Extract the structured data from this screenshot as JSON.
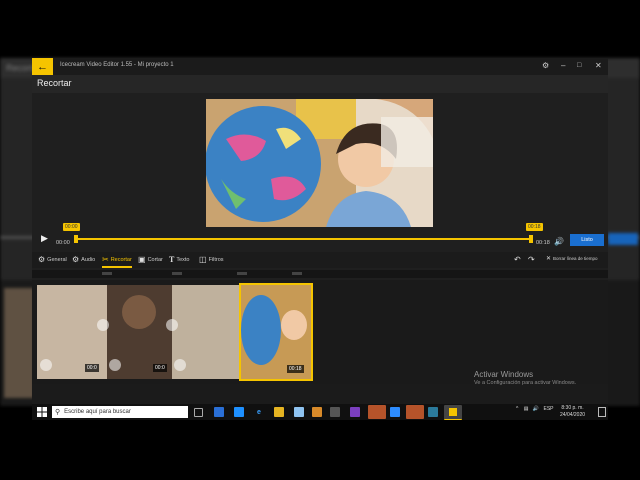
{
  "background_app": {
    "title": "Recorta"
  },
  "window": {
    "title": "Icecream Video Editor 1.55  -  Mi proyecto 1"
  },
  "header": {
    "title": "Recortar"
  },
  "player": {
    "start_marker": "00:00",
    "end_marker": "00:18",
    "current_time": "00:00",
    "total_time": "00:18",
    "done_label": "Listo"
  },
  "tools": [
    {
      "label": "General",
      "icon": "gear-icon"
    },
    {
      "label": "Audio",
      "icon": "audio-icon"
    },
    {
      "label": "Recortar",
      "icon": "scissors-icon",
      "active": true
    },
    {
      "label": "Cortar",
      "icon": "crop-icon"
    },
    {
      "label": "Texto",
      "icon": "text-icon"
    },
    {
      "label": "Filtros",
      "icon": "filter-icon"
    }
  ],
  "timeline": {
    "clear_label": "Borrar línea de tiempo",
    "clip1_duration": "00:0",
    "clip2_duration": "00:0",
    "selected_duration": "00:18"
  },
  "activation": {
    "title": "Activar Windows",
    "subtitle": "Ve a Configuración para activar Windows."
  },
  "taskbar": {
    "search_placeholder": "Escribe aquí para buscar",
    "language": "ESP",
    "time": "8:30 p. m.",
    "date": "24/04/2020"
  },
  "colors": {
    "accent": "#f5c400",
    "button_blue": "#1a6fd0"
  }
}
